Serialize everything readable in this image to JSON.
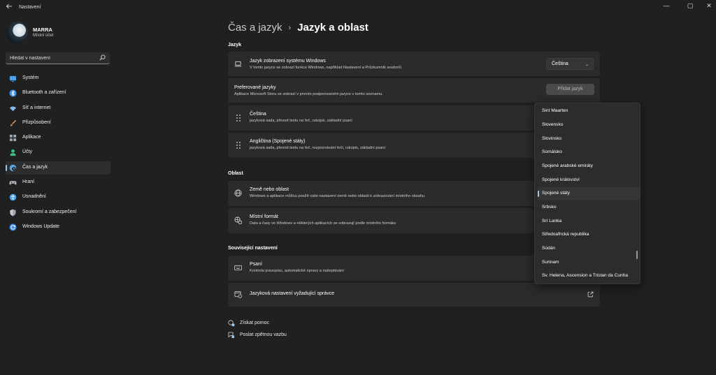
{
  "window": {
    "title": "Nastavení",
    "controls": {
      "minimize": "—",
      "maximize": "▢",
      "close": "✕"
    }
  },
  "user": {
    "name": "MARRA",
    "account": "Místní účet"
  },
  "search": {
    "placeholder": "Hledat v nastavení",
    "icon": "search-icon"
  },
  "sidebar": {
    "items": [
      {
        "label": "Systém",
        "icon": "monitor-icon",
        "color": "#4aa3f0"
      },
      {
        "label": "Bluetooth a zařízení",
        "icon": "bluetooth-icon",
        "color": "#3c8fe8"
      },
      {
        "label": "Síť a internet",
        "icon": "wifi-icon",
        "color": "#7fb9ee"
      },
      {
        "label": "Přizpůsobení",
        "icon": "brush-icon",
        "color": "#e0a060"
      },
      {
        "label": "Aplikace",
        "icon": "apps-icon",
        "color": "#9aa8b8"
      },
      {
        "label": "Účty",
        "icon": "person-icon",
        "color": "#3cc07a"
      },
      {
        "label": "Čas a jazyk",
        "icon": "globe-clock-icon",
        "color": "#5aa7e6",
        "active": true
      },
      {
        "label": "Hraní",
        "icon": "gamepad-icon",
        "color": "#b0b6bf"
      },
      {
        "label": "Usnadnění",
        "icon": "accessibility-icon",
        "color": "#4aa3f0"
      },
      {
        "label": "Soukromí a zabezpečení",
        "icon": "shield-icon",
        "color": "#9aa3ad"
      },
      {
        "label": "Windows Update",
        "icon": "update-icon",
        "color": "#3c8fe8"
      }
    ]
  },
  "breadcrumb": {
    "parent": "Čas a jazyk",
    "separator": "›",
    "current": "Jazyk a oblast"
  },
  "sections": {
    "jazyk": "Jazyk",
    "oblast": "Oblast",
    "related": "Související nastavení"
  },
  "cards": {
    "display_language": {
      "title": "Jazyk zobrazení systému Windows",
      "desc": "V tomto jazyce se zobrazí funkce Windows, například Nastavení a Průzkumník souborů.",
      "value": "Čeština",
      "chevron": "⌄"
    },
    "preferred": {
      "title": "Preferované jazyky",
      "desc": "Aplikace Microsoft Storu se zobrazí v prvním podporovaném jazyce v tomto seznamu.",
      "button": "Přidat jazyk"
    },
    "lang_cs": {
      "title": "Čeština",
      "desc": "jazyková sada, převod textu na řeč, rukopis, základní psaní"
    },
    "lang_en": {
      "title": "Angličtina (Spojené státy)",
      "desc": "jazyková sada, převod textu na řeč, rozpoznávání řeči, rukopis, základní psaní"
    },
    "country": {
      "title": "Země nebo oblast",
      "desc": "Windows a aplikace můžou použít vaše nastavení země nebo oblasti k zobrazování místního obsahu."
    },
    "format": {
      "title": "Místní formát",
      "desc": "Data a časy ve Windows a některých aplikacích se zobrazují podle místního formátu."
    },
    "typing": {
      "title": "Psaní",
      "desc": "Kontrola pravopisu, automatické opravy a našeptávání"
    },
    "admin": {
      "title": "Jazyková nastavení vyžadující správce"
    }
  },
  "dropdown": {
    "items": [
      "Sint Maarten",
      "Slovensko",
      "Slovinsko",
      "Somálsko",
      "Spojené arabské emiráty",
      "Spojené království",
      "Spojené státy",
      "Srbsko",
      "Srí Lanka",
      "Středoafrická republika",
      "Súdán",
      "Surinam",
      "Sv. Helena, Ascension a Tristan da Cunha"
    ],
    "selected": "Spojené státy"
  },
  "footer": {
    "help": "Získat pomoc",
    "feedback": "Poslat zpětnou vazbu"
  },
  "colors": {
    "background": "#202020",
    "card": "#2b2b2b",
    "accent": "#9fc6e8"
  }
}
